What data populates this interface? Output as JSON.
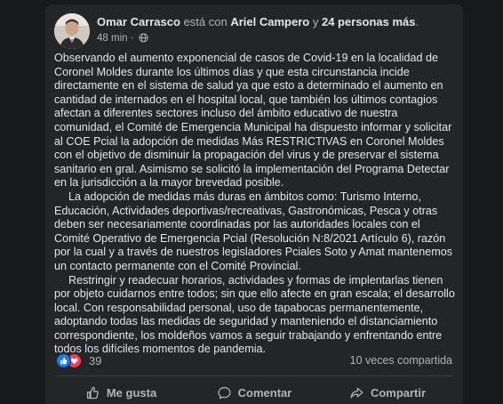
{
  "post": {
    "author": "Omar Carrasco",
    "with_connector": "está con",
    "tagged_person": "Ariel Campero",
    "and_connector": "y",
    "others": "24 personas más",
    "time": "48 min",
    "dot": "·",
    "privacy_icon": "globe-icon",
    "paragraphs": [
      "Observando el aumento exponencial de casos de Covid-19 en la localidad de Coronel Moldes durante los últimos días y que esta circunstancia incide directamente en el sistema de salud ya que esto a determinado el aumento en cantidad de internados en el hospital local, que también los últimos contagios afectan a diferentes sectores incluso del ámbito educativo de nuestra comunidad, el Comité de Emergencia Municipal ha dispuesto informar y solicitar al COE Pcial la adopción de medidas Más RESTRICTIVAS en Coronel Moldes con el objetivo de disminuir la propagación del virus y de preservar el sistema sanitario en gral. Asimismo se solicitó la implementación del Programa Detectar en la jurisdicción a la mayor brevedad posible.",
      "La adopción de medidas más duras en ámbitos como: Turismo Interno, Educación, Actividades deportivas/recreativas, Gastronómicas, Pesca y otras deben ser necesariamente coordinadas por las autoridades locales con el Comité Operativo de Emergencia Pcial (Resolución N:8/2021 Artículo 6), razón por la cual y a través de nuestros legisladores Pciales Soto y Amat mantenemos un contacto permanente con el Comité Provincial.",
      "Restringir y readecuar horarios, actividades y formas de implentarlas tienen por objeto cuidarnos entre todos; sin que ello afecte en gran escala; el desarrollo local. Con responsabilidad personal, uso de tapabocas permanentemente, adoptando todas las medidas de seguridad y manteniendo el distanciamiento correspondiente, los moldeños vamos a seguir trabajando y enfrentando entre todos los difíciles momentos de pandemia."
    ],
    "reaction_count": "39",
    "reaction_icons": [
      "like-icon",
      "love-icon"
    ],
    "shares": "10 veces compartida"
  },
  "actions": {
    "like_label": "Me gusta",
    "comment_label": "Comentar",
    "share_label": "Compartir"
  },
  "colors": {
    "page_bg": "#18191a",
    "card_bg": "#242526",
    "primary_text": "#e4e6eb",
    "secondary_text": "#b0b3b8",
    "like_blue": "#1877f2",
    "love_red": "#f33e58"
  }
}
